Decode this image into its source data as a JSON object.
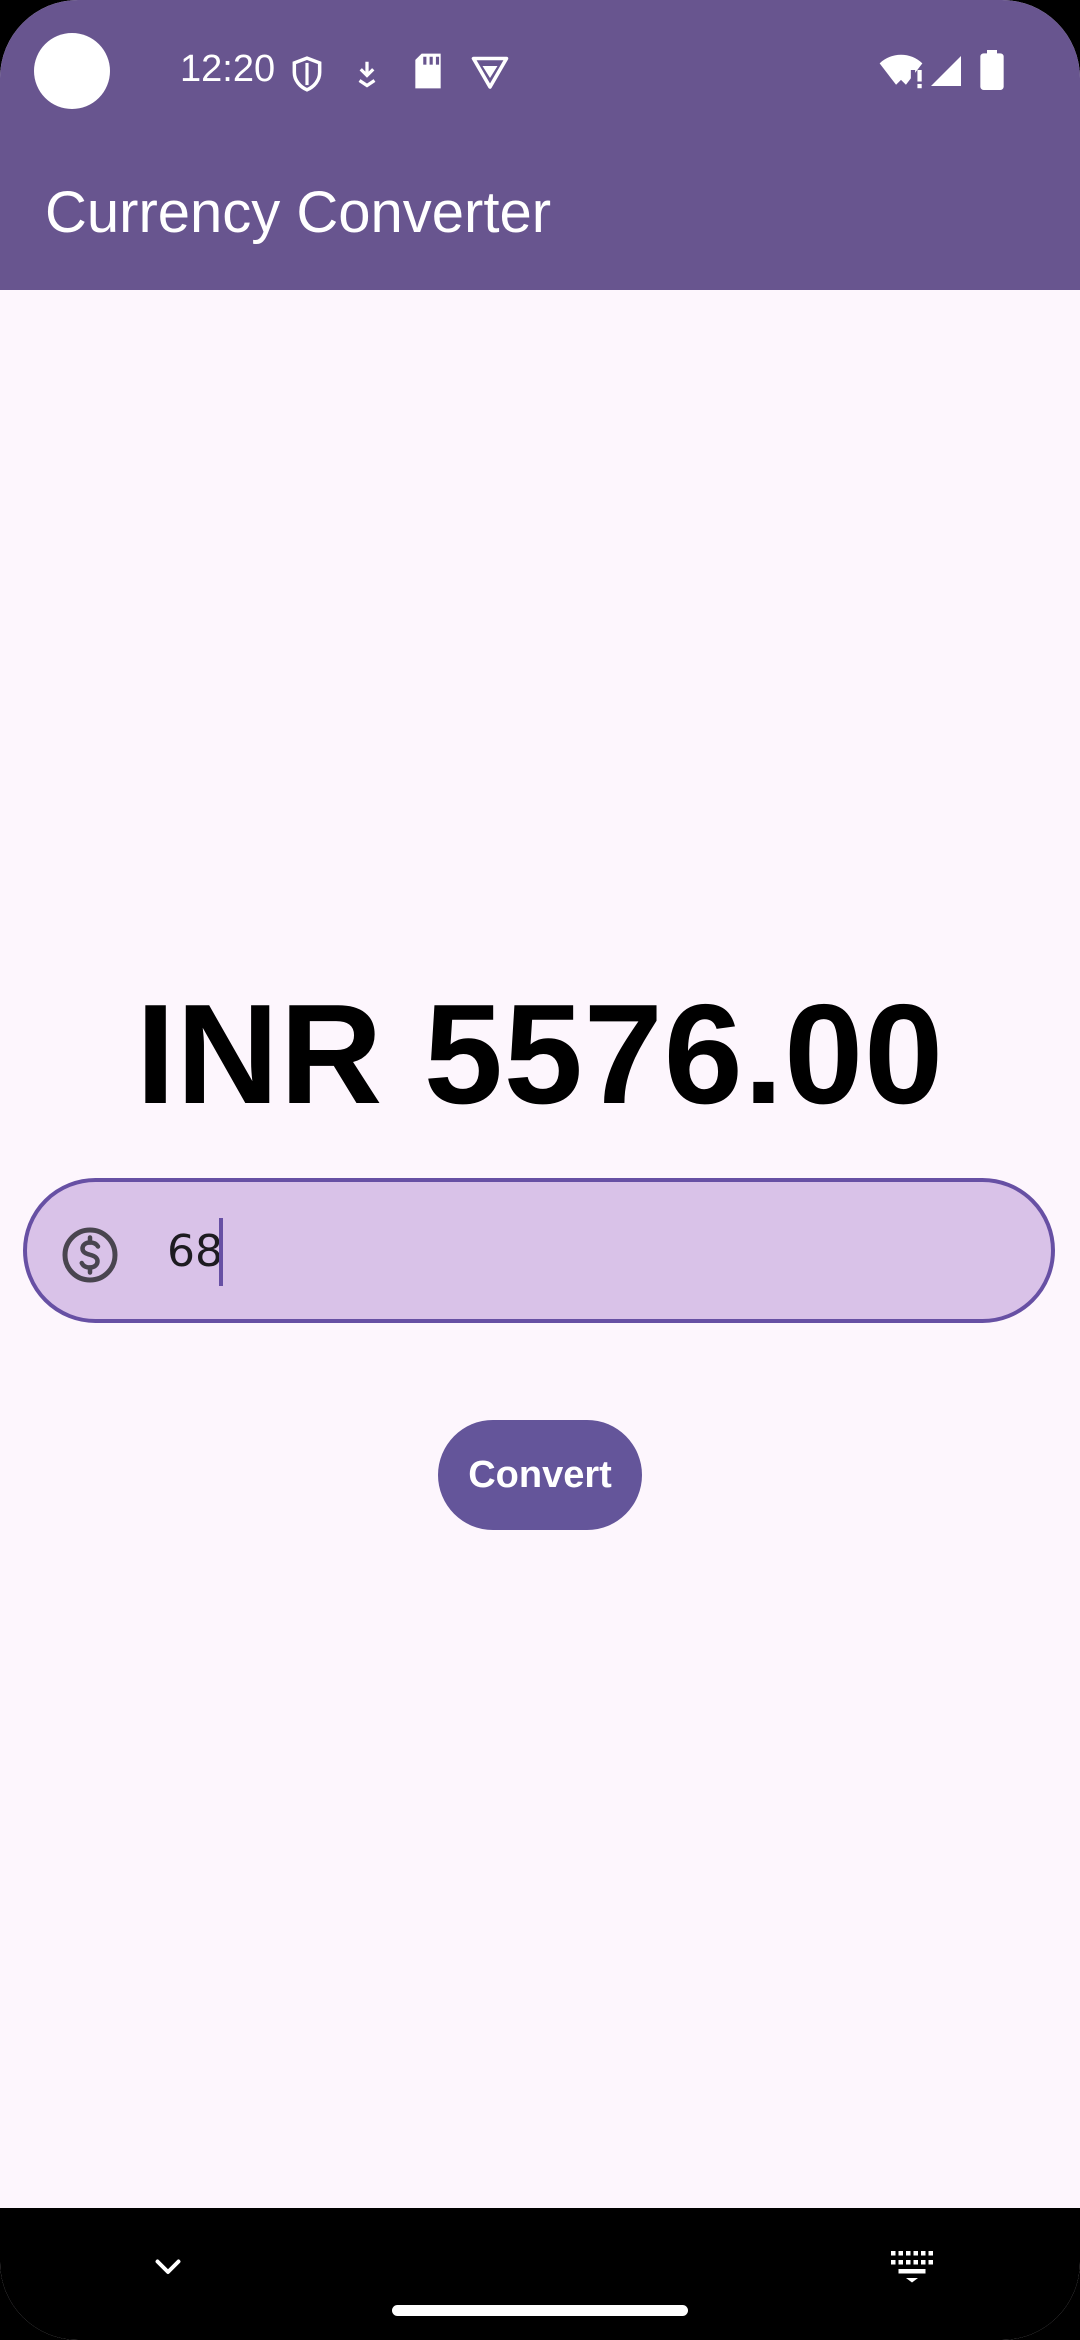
{
  "status_bar": {
    "time": "12:20",
    "left_icons": [
      "shield-icon",
      "download-icon",
      "sd-card-icon",
      "vpn-icon"
    ],
    "right_icons": [
      "wifi-icon",
      "signal-icon",
      "battery-icon"
    ]
  },
  "app_bar": {
    "title": "Currency Converter"
  },
  "main": {
    "result": "INR 5576.00",
    "amount_input": {
      "value": "68",
      "leading_icon": "dollar-icon"
    },
    "convert_label": "Convert"
  },
  "nav_bar": {
    "icons": [
      "chevron-down-icon",
      "home-handle",
      "keyboard-icon"
    ]
  },
  "colors": {
    "primary": "#68558F",
    "background": "#FDF6FD",
    "field_fill": "#D9C2E8",
    "field_border": "#6750A4",
    "button": "#64559A"
  }
}
